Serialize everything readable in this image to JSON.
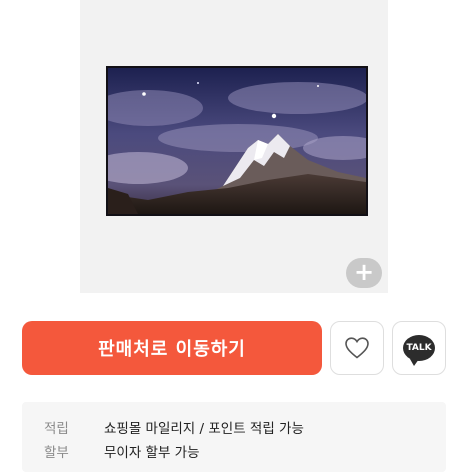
{
  "buttons": {
    "zoom_label": "+",
    "buy_label": "판매처로 이동하기",
    "talk_label": "TALK"
  },
  "info": {
    "rows": [
      {
        "key": "적립",
        "value": "쇼핑몰 마일리지 / 포인트 적립 가능"
      },
      {
        "key": "할부",
        "value": "무이자 할부 가능"
      }
    ]
  },
  "icons": {
    "wish": "heart-outline-icon",
    "talk": "kakao-talk-icon",
    "zoom": "plus-icon"
  },
  "colors": {
    "accent": "#f4583c",
    "image_bg": "#f2f2f2",
    "info_bg": "#f6f6f6"
  }
}
